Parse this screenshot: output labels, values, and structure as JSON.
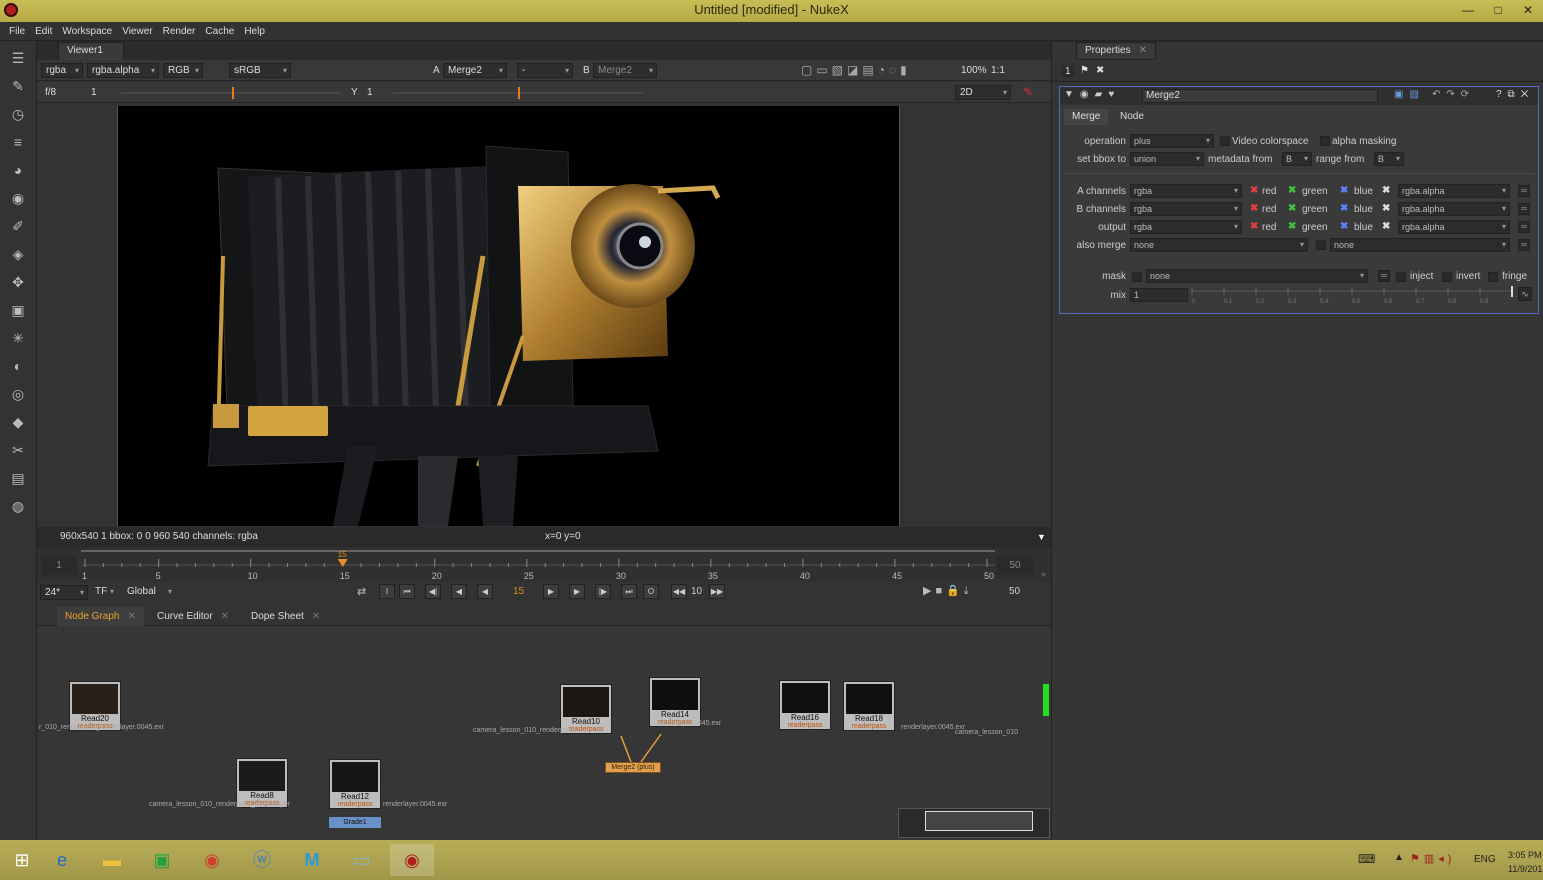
{
  "window": {
    "title": "Untitled [modified] - NukeX",
    "min": "—",
    "max": "□",
    "close": "✕"
  },
  "menu": [
    "File",
    "Edit",
    "Workspace",
    "Viewer",
    "Render",
    "Cache",
    "Help"
  ],
  "viewer": {
    "tab": "Viewer1",
    "channels": "rgba",
    "alpha": "rgba.alpha",
    "colorspace_mode": "RGB",
    "lut": "sRGB",
    "input_a_label": "A",
    "input_a": "Merge2",
    "input_mid": "-",
    "input_b_label": "B",
    "input_b": "Merge2",
    "zoom": "100%",
    "ratio": "1:1",
    "fstop": "f/8",
    "gain": "1",
    "gamma_label": "Y",
    "gamma": "1",
    "gain_ticks": [
      "0.0625",
      "0.1",
      "0.2",
      "0.5",
      "1",
      "2",
      "5",
      "10",
      "20",
      "40"
    ],
    "gamma_ticks": [
      "0",
      "0.2",
      "0.4",
      "0.6",
      "0.8",
      "1",
      "2",
      "4"
    ],
    "view_mode": "2D",
    "info": "960x540 1  bbox: 0 0 960 540 channels: rgba",
    "coords": "x=0 y=0"
  },
  "timeline": {
    "start": "1",
    "end": "50",
    "current": "15",
    "ticks": [
      "1",
      "5",
      "10",
      "15",
      "20",
      "25",
      "30",
      "35",
      "40",
      "45",
      "50"
    ],
    "fps": "24*",
    "tf": "TF",
    "scope": "Global",
    "step": "10",
    "end_frame": "50"
  },
  "graph_tabs": [
    "Node Graph",
    "Curve Editor",
    "Dope Sheet"
  ],
  "nodes": [
    {
      "label": "Read20",
      "sub": "readerpass"
    },
    {
      "label": "Read8",
      "sub": "readerpass"
    },
    {
      "label": "Read12",
      "sub": "readerpass"
    },
    {
      "label": "Read10",
      "sub": "readerpass"
    },
    {
      "label": "Read14",
      "sub": "readerpass"
    },
    {
      "label": "Read16",
      "sub": "readerpass"
    },
    {
      "label": "Read18",
      "sub": "readerpass"
    }
  ],
  "node_captions": {
    "read20": "r_010_renderpass_renderlayer.0045.exr",
    "read8": "camera_lesson_010_renderpass_renderlayer",
    "read12": "renderlayer.0045.exr",
    "read10": "camera_lesson_010_renderpass",
    "read14": "renderlayer.0045.exr",
    "read18": "renderlayer.0045.exr",
    "right": "camera_lesson_010"
  },
  "merge_node": "Merge2 (plus)",
  "grade_node": "Grade1",
  "properties": {
    "tab": "Properties",
    "count": "1",
    "node_name": "Merge2",
    "tabs": [
      "Merge",
      "Node"
    ],
    "operation_label": "operation",
    "operation": "plus",
    "video_colorspace": "Video colorspace",
    "alpha_masking": "alpha masking",
    "bbox_label": "set bbox to",
    "bbox": "union",
    "metadata_label": "metadata from",
    "metadata": "B",
    "range_label": "range from",
    "range": "B",
    "a_channels_label": "A channels",
    "b_channels_label": "B channels",
    "output_label": "output",
    "channels_value": "rgba",
    "red": "red",
    "green": "green",
    "blue": "blue",
    "alpha_value": "rgba.alpha",
    "also_merge_label": "also merge",
    "also_merge": "none",
    "also_merge2": "none",
    "mask_label": "mask",
    "mask": "none",
    "inject": "inject",
    "invert": "invert",
    "fringe": "fringe",
    "mix_label": "mix",
    "mix": "1",
    "mix_ticks": [
      "0",
      "0.1",
      "0.2",
      "0.3",
      "0.4",
      "0.5",
      "0.6",
      "0.7",
      "0.8",
      "0.9"
    ]
  },
  "taskbar": {
    "lang": "ENG",
    "time": "3:05 PM",
    "date": "11/9/201"
  }
}
